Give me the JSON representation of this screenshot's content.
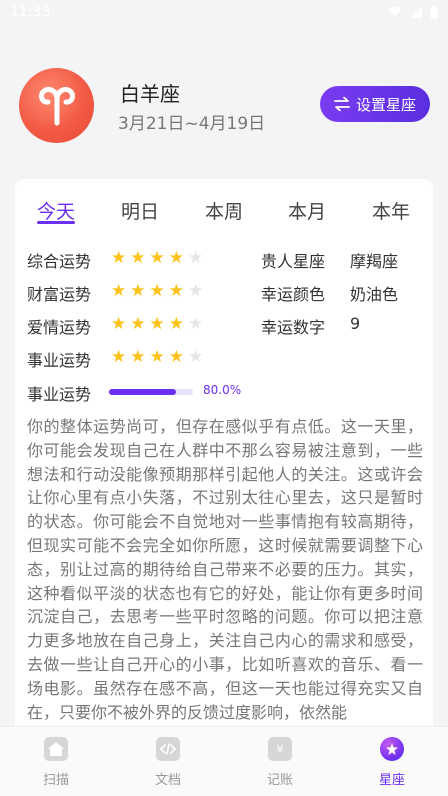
{
  "status_bar": {
    "time": "11:33"
  },
  "header": {
    "sign_name": "白羊座",
    "date_range": "3月21日~4月19日",
    "set_button_label": "设置星座",
    "avatar_icon": "aries-symbol-icon"
  },
  "tabs": [
    {
      "label": "今天",
      "active": true
    },
    {
      "label": "明日",
      "active": false
    },
    {
      "label": "本周",
      "active": false
    },
    {
      "label": "本月",
      "active": false
    },
    {
      "label": "本年",
      "active": false
    }
  ],
  "ratings": [
    {
      "label": "综合运势",
      "stars": 4,
      "max": 5
    },
    {
      "label": "财富运势",
      "stars": 4,
      "max": 5
    },
    {
      "label": "爱情运势",
      "stars": 4,
      "max": 5
    },
    {
      "label": "事业运势",
      "stars": 4,
      "max": 5
    }
  ],
  "info": [
    {
      "label": "贵人星座",
      "value": "摩羯座"
    },
    {
      "label": "幸运颜色",
      "value": "奶油色"
    },
    {
      "label": "幸运数字",
      "value": "9"
    }
  ],
  "progress": {
    "label": "事业运势",
    "percent": 80.0,
    "text": "80.0%"
  },
  "description": "你的整体运势尚可，但存在感似乎有点低。这一天里，你可能会发现自己在人群中不那么容易被注意到，一些想法和行动没能像预期那样引起他人的关注。这或许会让你心里有点小失落，不过别太往心里去，这只是暂时的状态。你可能会不自觉地对一些事情抱有较高期待，但现实可能不会完全如你所愿，这时候就需要调整下心态，别让过高的期待给自己带来不必要的压力。其实，这种看似平淡的状态也有它的好处，能让你有更多时间沉淀自己，去思考一些平时忽略的问题。你可以把注意力更多地放在自己身上，关注自己内心的需求和感受，去做一些让自己开心的小事，比如听喜欢的音乐、看一场电影。虽然存在感不高，但这一天也能过得充实又自在，只要你不被外界的反馈过度影响，依然能",
  "bottom_nav": [
    {
      "label": "扫描",
      "icon": "home-icon",
      "active": false
    },
    {
      "label": "文档",
      "icon": "code-document-icon",
      "active": false
    },
    {
      "label": "记账",
      "icon": "yuan-ledger-icon",
      "active": false
    },
    {
      "label": "星座",
      "icon": "star-planet-icon",
      "active": true
    }
  ],
  "colors": {
    "accent": "#6a2ff0",
    "star_on": "#ffc21a",
    "avatar": "#f25a45"
  }
}
